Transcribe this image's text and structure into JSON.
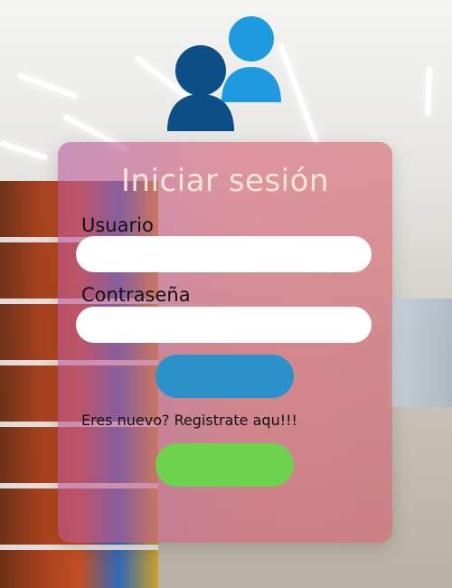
{
  "page": {
    "title": "Iniciar sesión",
    "username_label": "Usuario",
    "username_value": "",
    "username_placeholder": "",
    "password_label": "Contraseña",
    "password_value": "",
    "password_placeholder": "",
    "login_button_label": "",
    "register_prompt": "Eres nuevo? Registrate aqu!!!",
    "register_button_label": ""
  },
  "icons": {
    "users_icon": "users-icon"
  },
  "colors": {
    "card_overlay": "#D65A6E",
    "title_color": "#F8E7D7",
    "login_button": "#2A92C8",
    "register_button": "#6DD24E",
    "icon_dark_blue": "#0B4F86",
    "icon_light_blue": "#1E9BE0"
  }
}
